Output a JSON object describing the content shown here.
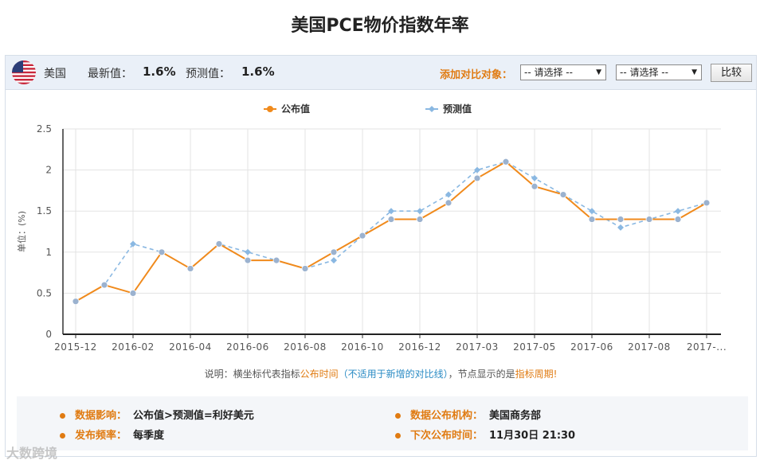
{
  "page_title": "美国PCE物价指数年率",
  "header": {
    "country": "美国",
    "latest_label": "最新值：",
    "latest_value": "1.6%",
    "forecast_label": "预测值：",
    "forecast_value": "1.6%",
    "compare_label": "添加对比对象：",
    "select1": "-- 请选择 --",
    "select2": "-- 请选择 --",
    "compare_button": "比较"
  },
  "note": {
    "prefix": "说明：横坐标代表指标",
    "publish_time": "公布时间",
    "paren": "（不适用于新增的对比线）",
    "mid": "，节点显示的是",
    "period": "指标周期!"
  },
  "info": {
    "impact_label": "数据影响：",
    "impact_value": "公布值>预测值=利好美元",
    "agency_label": "数据公布机构：",
    "agency_value": "美国商务部",
    "freq_label": "发布频率：",
    "freq_value": "每季度",
    "next_label": "下次公布时间：",
    "next_value": "11月30日 21:30"
  },
  "watermark": "大数跨境",
  "colors": {
    "published": "#f08a1c",
    "forecast": "#8ab8e2",
    "accent": "#e07b12"
  },
  "chart_data": {
    "type": "line",
    "ylabel": "单位：(%)",
    "ylim": [
      0,
      2.5
    ],
    "yticks": [
      "0",
      "0.5",
      "1",
      "1.5",
      "2",
      "2.5"
    ],
    "xtick_labels": [
      "2015-12",
      "2016-02",
      "2016-04",
      "2016-06",
      "2016-08",
      "2016-10",
      "2016-12",
      "2017-03",
      "2017-05",
      "2017-06",
      "2017-08",
      "2017-..."
    ],
    "legend_position": "top",
    "grid": true,
    "series": [
      {
        "name": "公布值",
        "values": [
          0.4,
          0.6,
          0.5,
          1.0,
          0.8,
          1.1,
          0.9,
          0.9,
          0.8,
          1.0,
          1.2,
          1.4,
          1.4,
          1.6,
          1.9,
          2.1,
          1.8,
          1.7,
          1.4,
          1.4,
          1.4,
          1.4,
          1.6
        ]
      },
      {
        "name": "预测值",
        "values": [
          0.4,
          0.6,
          1.1,
          1.0,
          0.8,
          1.1,
          1.0,
          0.9,
          0.8,
          0.9,
          1.2,
          1.5,
          1.5,
          1.7,
          2.0,
          2.1,
          1.9,
          1.7,
          1.5,
          1.3,
          1.4,
          1.5,
          1.6
        ]
      }
    ]
  }
}
